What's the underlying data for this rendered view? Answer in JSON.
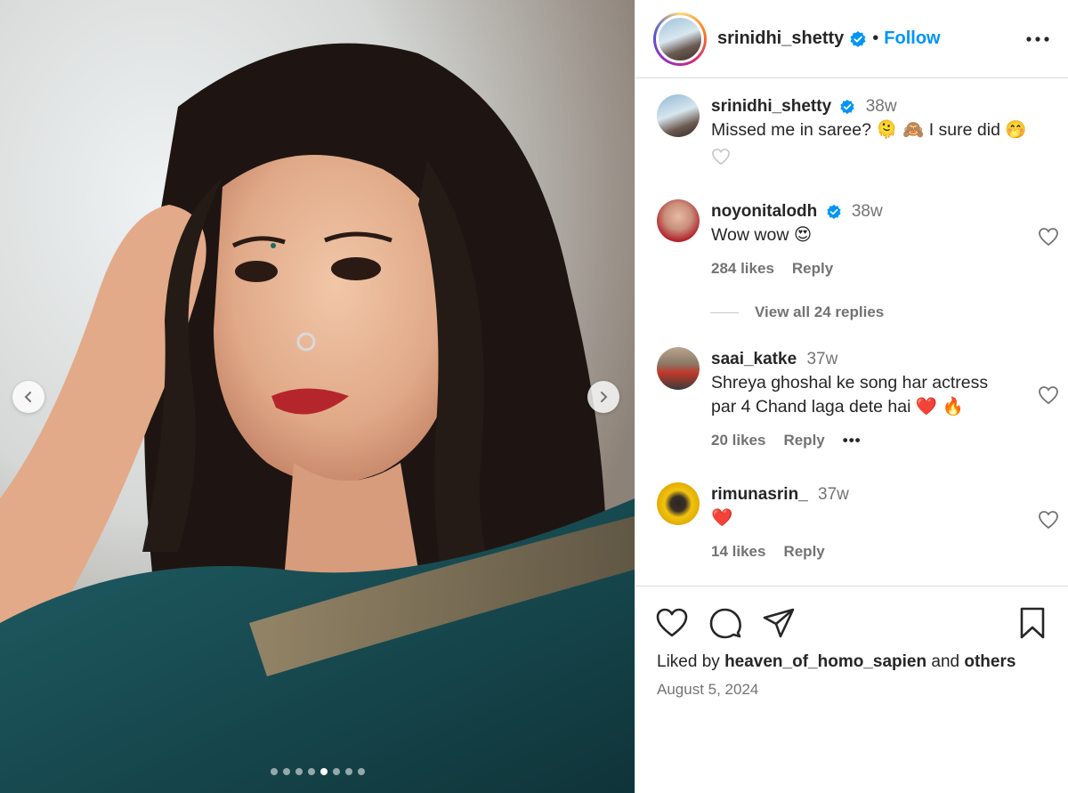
{
  "media": {
    "carousel_dots": 8,
    "active_dot_index": 4
  },
  "header": {
    "username": "srinidhi_shetty",
    "separator": "•",
    "follow_label": "Follow"
  },
  "caption": {
    "username": "srinidhi_shetty",
    "time": "38w",
    "text": "Missed me in saree? 🫠 🙈 I sure did 🤭"
  },
  "comments": [
    {
      "username": "noyonitalodh",
      "verified": true,
      "time": "38w",
      "text": "Wow wow 😍",
      "likes": "284 likes",
      "reply": "Reply"
    },
    {
      "username": "saai_katke",
      "verified": false,
      "time": "37w",
      "text_line1": "Shreya ghoshal ke song har actress",
      "text_line2": "par 4 Chand laga dete hai ❤️ 🔥",
      "likes": "20 likes",
      "reply": "Reply",
      "more": "•••"
    },
    {
      "username": "rimunasrin_",
      "verified": false,
      "time": "37w",
      "text": "❤️",
      "likes": "14 likes",
      "reply": "Reply"
    }
  ],
  "view_replies": "View all 24 replies",
  "footer": {
    "liked_prefix": "Liked by",
    "liked_user": "heaven_of_homo_sapien",
    "liked_and": "and",
    "liked_others": "others",
    "date": "August 5, 2024"
  },
  "colors": {
    "accent": "#0095f6",
    "verified": "#0095f6",
    "muted": "#737373"
  }
}
